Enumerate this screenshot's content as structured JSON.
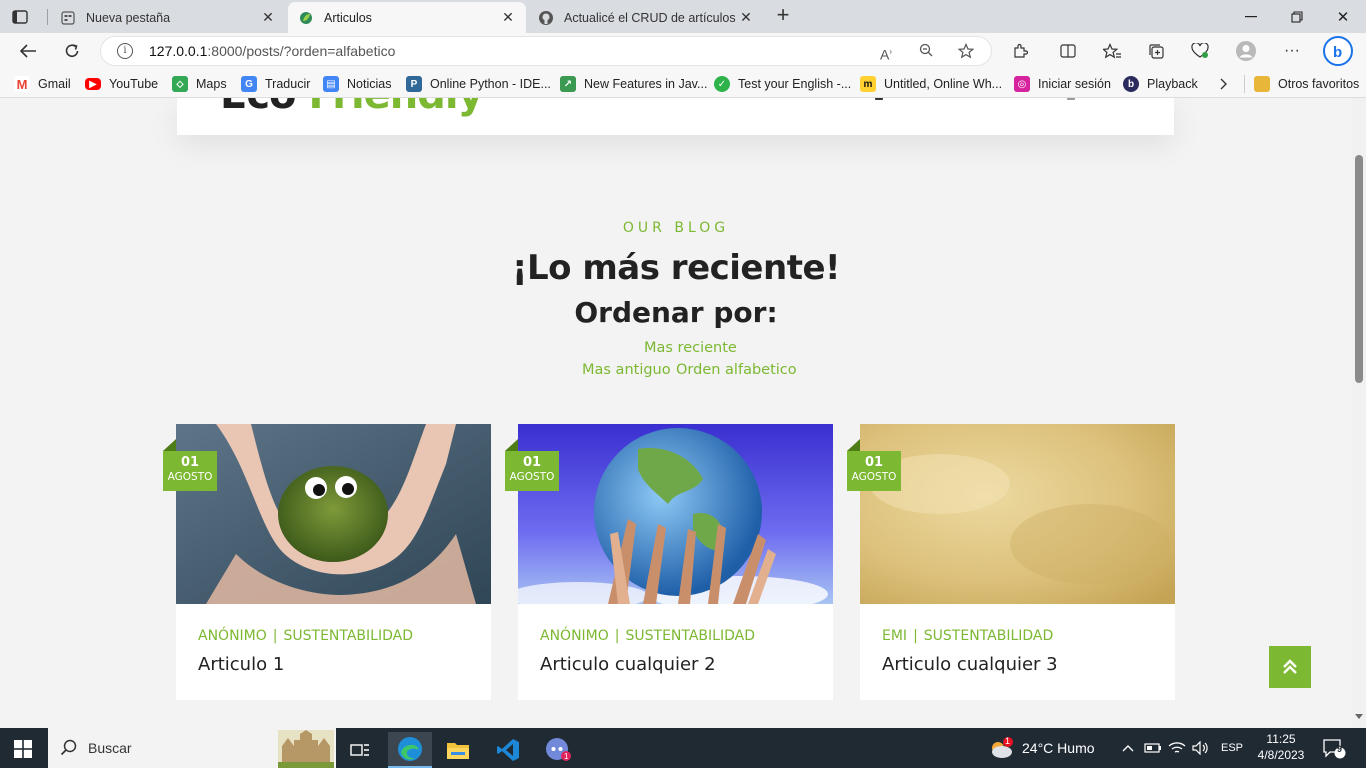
{
  "browser": {
    "tabs": [
      {
        "title": "Nueva pestaña",
        "active": false,
        "icon": "new-tab-page-icon"
      },
      {
        "title": "Articulos",
        "active": true,
        "icon": "eco-leaf-icon"
      },
      {
        "title": "Actualicé el CRUD de artículos y a",
        "active": false,
        "icon": "github-icon"
      }
    ],
    "address": {
      "url_host": "127.0.0.1",
      "url_rest": ":8000/posts/?orden=alfabetico"
    },
    "bookmarks": [
      {
        "label": "Gmail",
        "icon": "gmail-icon",
        "color": "#ea4335"
      },
      {
        "label": "YouTube",
        "icon": "youtube-icon",
        "color": "#ff0000"
      },
      {
        "label": "Maps",
        "icon": "maps-icon",
        "color": "#34a853"
      },
      {
        "label": "Traducir",
        "icon": "translate-icon",
        "color": "#4285f4"
      },
      {
        "label": "Noticias",
        "icon": "news-icon",
        "color": "#4285f4"
      },
      {
        "label": "Online Python - IDE...",
        "icon": "python-icon",
        "color": "#306998"
      },
      {
        "label": "New Features in Jav...",
        "icon": "java-icon",
        "color": "#3b9a52"
      },
      {
        "label": "Test your English -...",
        "icon": "check-icon",
        "color": "#2db34a"
      },
      {
        "label": "Untitled, Online Wh...",
        "icon": "miro-icon",
        "color": "#ffd02f"
      },
      {
        "label": "Iniciar sesión",
        "icon": "instagram-icon",
        "color": "#d6249f"
      },
      {
        "label": "Playback",
        "icon": "playback-icon",
        "color": "#2b2b5e"
      }
    ],
    "other_favorites": "Otros favoritos"
  },
  "page": {
    "section_sub": "OUR BLOG",
    "section_title": "¡Lo más reciente!",
    "order_title": "Ordenar por:",
    "order_links": {
      "recent": "Mas reciente",
      "oldest": "Mas antiguo",
      "alpha": "Orden alfabetico"
    },
    "posts": [
      {
        "day": "01",
        "month": "AGOSTO",
        "author": "ANÓNIMO",
        "category": "SUSTENTABILIDAD",
        "title": "Articulo 1"
      },
      {
        "day": "01",
        "month": "AGOSTO",
        "author": "ANÓNIMO",
        "category": "SUSTENTABILIDAD",
        "title": "Articulo cualquier 2"
      },
      {
        "day": "01",
        "month": "AGOSTO",
        "author": "EMI",
        "category": "SUSTENTABILIDAD",
        "title": "Articulo cualquier 3"
      }
    ],
    "meta_separator": "|"
  },
  "taskbar": {
    "search_label": "Buscar",
    "weather": "24°C  Humo",
    "weather_badge": "1",
    "language": "ESP",
    "time": "11:25",
    "date": "4/8/2023",
    "notifications": "9"
  },
  "colors": {
    "accent": "#7cb832",
    "title": "#222222",
    "background": "#f3f3f3"
  }
}
